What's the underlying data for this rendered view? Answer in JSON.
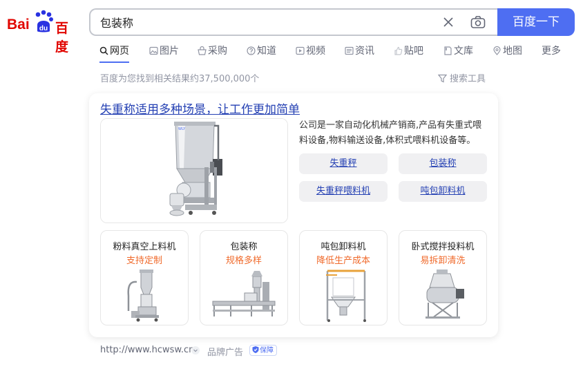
{
  "header": {
    "logo_text_left": "Bai",
    "logo_text_mid": "du",
    "logo_text_right": "百度",
    "search_value": "包装称",
    "search_button": "百度一下",
    "icons": [
      "clear-icon",
      "camera-icon"
    ]
  },
  "tabs": [
    {
      "label": "网页",
      "icon": "search-icon",
      "active": true
    },
    {
      "label": "图片",
      "icon": "image-icon"
    },
    {
      "label": "采购",
      "icon": "shopping-basket-icon"
    },
    {
      "label": "知道",
      "icon": "question-icon"
    },
    {
      "label": "视频",
      "icon": "video-icon"
    },
    {
      "label": "资讯",
      "icon": "news-icon"
    },
    {
      "label": "贴吧",
      "icon": "tieba-icon"
    },
    {
      "label": "文库",
      "icon": "doc-icon"
    },
    {
      "label": "地图",
      "icon": "map-icon"
    },
    {
      "label": "更多"
    }
  ],
  "result_count": "百度为您找到相关结果约37,500,000个",
  "search_tools": "搜索工具",
  "ad": {
    "title": "失重称适用多种场景，让工作更加简单",
    "description": "公司是一家自动化机械产销商,产品有失重式喂料设备,物料输送设备,体积式喂料机设备等。",
    "links": [
      "失重秤",
      "包装称",
      "失重秤喂料机",
      "吨包卸料机"
    ],
    "products": [
      {
        "name": "粉料真空上料机",
        "sub": "支持定制"
      },
      {
        "name": "包装称",
        "sub": "规格多样"
      },
      {
        "name": "吨包卸料机",
        "sub": "降低生产成本"
      },
      {
        "name": "卧式搅拌投料机",
        "sub": "易拆卸清洗"
      }
    ]
  },
  "footer": {
    "url": "http://www.hcwsw.cn",
    "brand_ad": "品牌广告",
    "guarantee": "保障"
  },
  "colors": {
    "accent": "#4e6ef2",
    "link": "#2440b3",
    "promo": "#f06a2b"
  }
}
